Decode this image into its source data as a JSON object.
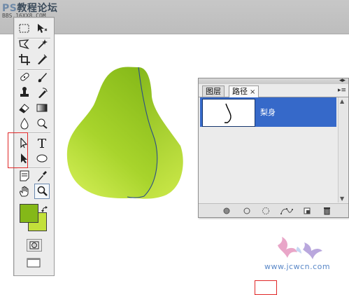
{
  "watermark_top": {
    "title_prefix": "PS",
    "title_rest": "教程论坛",
    "subtitle": "BBS.16XX8.COM"
  },
  "toolbox": {
    "tools": [
      {
        "name": "marquee",
        "label": "⬚"
      },
      {
        "name": "move",
        "label": "✥"
      },
      {
        "name": "lasso",
        "label": "ʘ"
      },
      {
        "name": "magic-wand",
        "label": "✦"
      },
      {
        "name": "crop",
        "label": "⌗"
      },
      {
        "name": "slice",
        "label": "⟋"
      },
      {
        "name": "healing",
        "label": "✚"
      },
      {
        "name": "brush",
        "label": "✎"
      },
      {
        "name": "stamp",
        "label": "♜"
      },
      {
        "name": "history-brush",
        "label": "⟳"
      },
      {
        "name": "eraser",
        "label": "▱"
      },
      {
        "name": "gradient",
        "label": "▮"
      },
      {
        "name": "blur",
        "label": "●"
      },
      {
        "name": "dodge",
        "label": "◐"
      },
      {
        "name": "path-selection",
        "label": "↖"
      },
      {
        "name": "type",
        "label": "T"
      },
      {
        "name": "direct-selection",
        "label": "➤"
      },
      {
        "name": "shape",
        "label": "⬭"
      },
      {
        "name": "notes",
        "label": "▤"
      },
      {
        "name": "eyedropper",
        "label": "⟋"
      },
      {
        "name": "hand",
        "label": "✋"
      },
      {
        "name": "zoom",
        "label": "⚲"
      }
    ],
    "colors": {
      "foreground": "#84b818",
      "background": "#c2e03a"
    }
  },
  "canvas": {
    "pear_colors": {
      "top": "#88bb1a",
      "bottom": "#d3ee56",
      "path_stroke": "#2b4d88"
    }
  },
  "paths_panel": {
    "tabs": [
      {
        "label": "图层",
        "active": false
      },
      {
        "label": "路径",
        "active": true
      }
    ],
    "close_glyph": "×",
    "rows": [
      {
        "name": "梨身",
        "selected": true
      }
    ],
    "bottom_buttons": [
      "fill-path",
      "stroke-path",
      "load-selection",
      "make-work-path",
      "new-path",
      "delete-path"
    ]
  },
  "watermark_bottom": {
    "text": "www.jcwcn.com"
  }
}
